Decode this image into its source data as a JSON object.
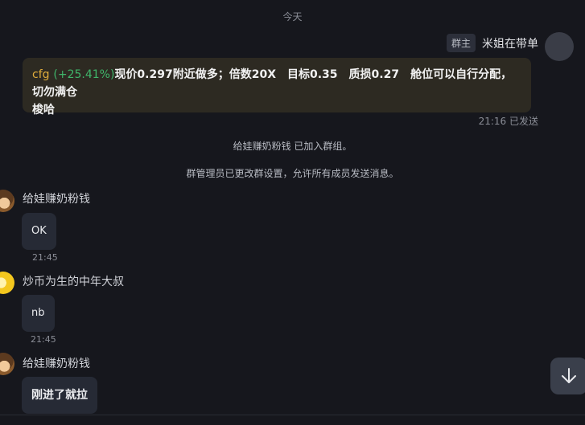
{
  "date_separator": "今天",
  "own_message": {
    "role_badge": "群主",
    "sender_name": "米姐在带单",
    "ticker": "cfg",
    "change": "(+25.41%)",
    "text_line1": "现价0.297附近做多；倍数20X　目标0.35　质损0.27　舱位可以自行分配，切勿满仓",
    "text_line2": "梭哈",
    "meta": "21:16 已发送"
  },
  "system_messages": [
    "给娃赚奶粉钱 已加入群组。",
    "群管理员已更改群设置，允许所有成员发送消息。"
  ],
  "messages": [
    {
      "sender": "给娃赚奶粉钱",
      "text": "OK",
      "time": "21:45",
      "avatar": "face-avatar"
    },
    {
      "sender": "炒币为生的中年大叔",
      "text": "nb",
      "time": "21:45",
      "avatar": "yellow-avatar"
    },
    {
      "sender": "给娃赚奶粉钱",
      "text": "刚进了就拉",
      "time": "",
      "avatar": "face-avatar"
    }
  ],
  "icons": {
    "scroll_down": "arrow-down-icon"
  },
  "colors": {
    "background": "#16171d",
    "own_bubble": "#2d2a22",
    "ticker": "#e0ad3c",
    "positive_change": "#3fb56a",
    "bubble": "#262a35"
  }
}
